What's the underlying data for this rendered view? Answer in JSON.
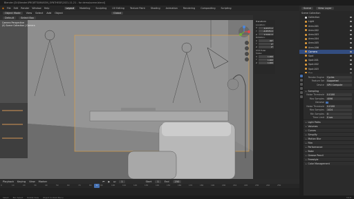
{
  "window": {
    "title": "Blender [D:\\Blender\\PROJETS\\MAISON_SYNTHESE\\2021-11-21 - for demo\\scene.blend]"
  },
  "menubar": {
    "menus": [
      "File",
      "Edit",
      "Render",
      "Window",
      "Help"
    ],
    "workspaces": [
      "Layout",
      "Modeling",
      "Sculpting",
      "UV Editing",
      "Texture Paint",
      "Shading",
      "Animation",
      "Rendering",
      "Compositing",
      "Scripting"
    ],
    "active_workspace": "Layout",
    "scene_label": "Scene",
    "view_layer_label": "View Layer"
  },
  "viewport_header": {
    "mode": "Object Mode",
    "menus": [
      "View",
      "Select",
      "Add",
      "Object"
    ],
    "orientation": "Global",
    "transform_label": "Default",
    "drag_label": "Select Box"
  },
  "viewport": {
    "overlay_title": "Camera Perspective",
    "overlay_subtitle": "(0) Scene Collection | Camera"
  },
  "npanel": {
    "section": "Transform",
    "location_label": "Location:",
    "loc": [
      {
        "axis": "X",
        "value": "4.6373 m"
      },
      {
        "axis": "Y",
        "value": "-4.6576 m"
      },
      {
        "axis": "Z",
        "value": "1.5441 m"
      }
    ],
    "rotation_label": "Rotation:",
    "rot": [
      {
        "axis": "X",
        "value": "90°"
      },
      {
        "axis": "Y",
        "value": "0°"
      },
      {
        "axis": "Z",
        "value": "0°"
      }
    ],
    "mode_label": "XYZ Euler",
    "scale_label": "Scale:",
    "scale": [
      {
        "axis": "X",
        "value": "1.000"
      },
      {
        "axis": "Y",
        "value": "1.000"
      },
      {
        "axis": "Z",
        "value": "1.000"
      }
    ]
  },
  "outliner": {
    "title": "Scene Collection",
    "items": [
      {
        "name": "Collection",
        "color": "#e0e0e0",
        "selected": false
      },
      {
        "name": "Light",
        "color": "#e6a03c",
        "selected": false
      },
      {
        "name": "Area.001",
        "color": "#e6a03c",
        "selected": false
      },
      {
        "name": "Area.002",
        "color": "#e6a03c",
        "selected": false
      },
      {
        "name": "Area.003",
        "color": "#e6a03c",
        "selected": false
      },
      {
        "name": "Area.004",
        "color": "#e6a03c",
        "selected": false
      },
      {
        "name": "Area.005",
        "color": "#e6a03c",
        "selected": false
      },
      {
        "name": "Area.006",
        "color": "#e6a03c",
        "selected": false
      },
      {
        "name": "Camera",
        "color": "#e6a03c",
        "selected": true
      },
      {
        "name": "Spot",
        "color": "#e6a03c",
        "selected": false
      },
      {
        "name": "Spot.001",
        "color": "#e6a03c",
        "selected": false
      },
      {
        "name": "Spot.002",
        "color": "#e6a03c",
        "selected": false
      },
      {
        "name": "Spot.003",
        "color": "#e6a03c",
        "selected": false
      },
      {
        "name": "Sun",
        "color": "#e6a03c",
        "selected": false
      }
    ]
  },
  "properties": {
    "rows": [
      {
        "label": "Render Engine",
        "value": "Cycles"
      },
      {
        "label": "Feature Set",
        "value": "Supported"
      },
      {
        "label": "Device",
        "value": "GPU Compute"
      }
    ],
    "sections": [
      "Sampling",
      "Light Paths",
      "Volumes",
      "Curves",
      "Simplify",
      "Motion Blur",
      "Film",
      "Performance",
      "Bake",
      "Grease Pencil",
      "Freestyle",
      "Color Management"
    ],
    "sampling_rows": [
      {
        "label": "Noise Threshold",
        "value": "0.0100"
      },
      {
        "label": "Max Samples",
        "value": "4096"
      },
      {
        "label": "Denoise",
        "value": ""
      },
      {
        "label": "Noise Threshold",
        "value": "0.0100"
      },
      {
        "label": "Max Samples",
        "value": "1024"
      },
      {
        "label": "Min Samples",
        "value": "0"
      },
      {
        "label": "Time Limit",
        "value": "0 sec"
      }
    ]
  },
  "timeline": {
    "menus": [
      "Playback",
      "Keying",
      "View",
      "Marker"
    ],
    "current_frame": "1",
    "start_label": "Start",
    "start": "1",
    "end_label": "End",
    "end": "250",
    "ticks": [
      "0",
      "10",
      "20",
      "30",
      "40",
      "50",
      "60",
      "70",
      "80",
      "90",
      "100",
      "110",
      "120",
      "130",
      "140",
      "150",
      "160",
      "170",
      "180",
      "190",
      "200",
      "210",
      "220",
      "230",
      "240",
      "250"
    ]
  },
  "statusbar": {
    "items": [
      "Select",
      "Box Select",
      "Rotate View",
      "Object Context Menu"
    ],
    "version": "3.0.0"
  }
}
